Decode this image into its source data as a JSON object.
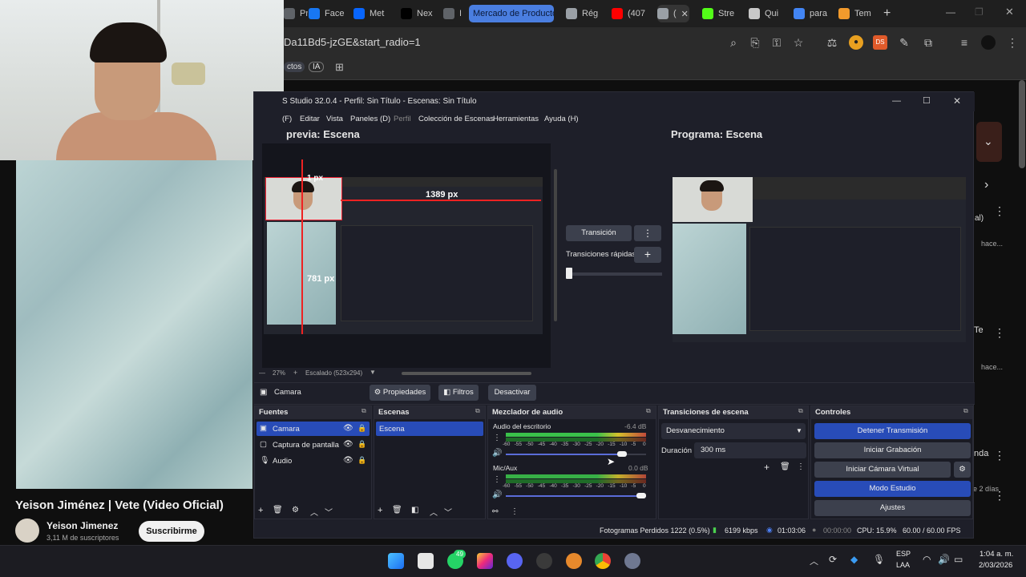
{
  "browser": {
    "tabs": [
      {
        "label": "Proj",
        "icon": "pro-icon",
        "color": "#5f6368"
      },
      {
        "label": "Face",
        "icon": "facebook-icon",
        "color": "#1877f2"
      },
      {
        "label": "Met",
        "icon": "meta-icon",
        "color": "#0866ff"
      },
      {
        "label": "Nex",
        "icon": "tiktok-icon",
        "color": "#000000"
      },
      {
        "label": "IA",
        "icon": "ia-icon",
        "color": "#5f6368"
      },
      {
        "label": "Mercado de Productos",
        "icon": "group-tab-icon",
        "color": "#4a7ee0"
      },
      {
        "label": "Rég",
        "icon": "opera-icon",
        "color": "#9aa0a6"
      },
      {
        "label": "(407",
        "icon": "youtube-icon",
        "color": "#ff0000"
      },
      {
        "label": "(",
        "icon": "audio-icon",
        "color": "#9aa0a6"
      },
      {
        "label": "Stre",
        "icon": "kick-icon",
        "color": "#53fc18"
      },
      {
        "label": "Qui",
        "icon": "chatgpt-icon",
        "color": "#c8c8c8"
      },
      {
        "label": "para",
        "icon": "google-icon",
        "color": "#4285f4"
      },
      {
        "label": "Tem",
        "icon": "template-icon",
        "color": "#f29a2c"
      }
    ],
    "new_tab": "+",
    "url": "Da11Bd5-jzGE&start_radio=1",
    "bookmarks": [
      "ctos",
      "IA"
    ]
  },
  "youtube": {
    "title": "Yeison Jiménez | Vete (Video Oficial)",
    "channel": "Yeison Jimenez",
    "subscribers": "3,11 M de suscriptores",
    "subscribe_label": "Suscribirme",
    "side_texts": [
      "al)",
      "hace...",
      "Te",
      "hace...",
      "nda",
      "e 2 días"
    ]
  },
  "obs": {
    "title": "S Studio 32.0.4 - Perfil: Sin Título - Escenas: Sin Título",
    "menu": [
      "(F)",
      "Editar",
      "Vista",
      "Paneles (D)",
      "Perfil",
      "Colección de Escenas",
      "Herramientas",
      "Ayuda (H)"
    ],
    "preview_label": "previa: Escena",
    "program_label": "Programa: Escena",
    "measure": {
      "top": "1 px",
      "right": "1389 px",
      "bottom": "781 px"
    },
    "zoom": "27%",
    "scaling": "Escalado (523x294)",
    "transition_button": "Transición",
    "quick_transitions": "Transiciones rápidas",
    "source_bar": {
      "current": "Camara",
      "properties": "Propiedades",
      "filters": "Filtros",
      "deactivate": "Desactivar"
    },
    "sources": {
      "header": "Fuentes",
      "items": [
        {
          "label": "Camara",
          "icon": "camera-icon"
        },
        {
          "label": "Captura de pantalla",
          "icon": "monitor-icon"
        },
        {
          "label": "Audio",
          "icon": "microphone-icon"
        }
      ]
    },
    "scenes": {
      "header": "Escenas",
      "items": [
        "Escena"
      ]
    },
    "mixer": {
      "header": "Mezclador de audio",
      "channels": [
        {
          "name": "Audio del escritorio",
          "db": "-6.4 dB",
          "level": 0.86
        },
        {
          "name": "Mic/Aux",
          "db": "0.0 dB",
          "level": 1.0
        }
      ],
      "scale": [
        "-60",
        "-55",
        "-50",
        "-45",
        "-40",
        "-35",
        "-30",
        "-25",
        "-20",
        "-15",
        "-10",
        "-5",
        "0"
      ]
    },
    "transitions": {
      "header": "Transiciones de escena",
      "selected": "Desvanecimiento",
      "duration_label": "Duración",
      "duration_value": "300 ms"
    },
    "controls": {
      "header": "Controles",
      "stop_stream": "Detener Transmisión",
      "start_recording": "Iniciar Grabación",
      "start_virtual_cam": "Iniciar Cámara Virtual",
      "studio_mode": "Modo Estudio",
      "settings": "Ajustes"
    },
    "status": {
      "dropped": "Fotogramas Perdidos 1222 (0.5%)",
      "bitrate": "6199 kbps",
      "stream_time": "01:03:06",
      "rec_time": "00:00:00",
      "cpu": "CPU: 15.9%",
      "fps": "60.00 / 60.00 FPS"
    }
  },
  "taskbar": {
    "badge": "49",
    "lang": "ESP",
    "lang2": "LAA",
    "time": "1:04 a. m.",
    "date": "2/03/2026"
  }
}
